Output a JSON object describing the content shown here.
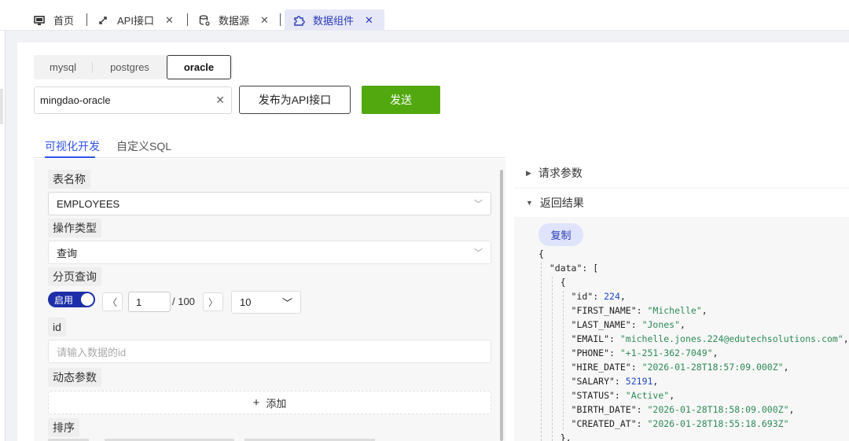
{
  "tabs": [
    {
      "label": "首页",
      "icon": "monitor-icon",
      "closable": false
    },
    {
      "label": "API接口",
      "icon": "link-icon",
      "closable": true
    },
    {
      "label": "数据源",
      "icon": "database-icon",
      "closable": true
    },
    {
      "label": "数据组件",
      "icon": "puzzle-icon",
      "closable": true,
      "active": true
    }
  ],
  "db_types": [
    "mysql",
    "postgres",
    "oracle"
  ],
  "db_selected": "oracle",
  "connection": {
    "value": "mingdao-oracle"
  },
  "actions": {
    "publish": "发布为API接口",
    "send": "发送"
  },
  "subtabs": [
    "可视化开发",
    "自定义SQL"
  ],
  "form": {
    "table_label": "表名称",
    "table_value": "EMPLOYEES",
    "op_label": "操作类型",
    "op_value": "查询",
    "paging_label": "分页查询",
    "paging_toggle": "启用",
    "page_current": "1",
    "page_total": "/ 100",
    "page_size": "10",
    "id_label": "id",
    "id_placeholder": "请输入数据的id",
    "dyn_label": "动态参数",
    "add_label": "添加",
    "sort_label": "排序"
  },
  "result": {
    "params_label": "请求参数",
    "result_label": "返回结果",
    "copy_label": "复制",
    "lines": [
      {
        "indent": 0,
        "k": "",
        "v": "{",
        "t": "p"
      },
      {
        "indent": 1,
        "k": "\"data\": ",
        "v": "[",
        "t": "p"
      },
      {
        "indent": 2,
        "k": "",
        "v": "{",
        "t": "p"
      },
      {
        "indent": 3,
        "k": "\"id\": ",
        "v": "224",
        "t": "n",
        "c": ","
      },
      {
        "indent": 3,
        "k": "\"FIRST_NAME\": ",
        "v": "\"Michelle\"",
        "t": "s",
        "c": ","
      },
      {
        "indent": 3,
        "k": "\"LAST_NAME\": ",
        "v": "\"Jones\"",
        "t": "s",
        "c": ","
      },
      {
        "indent": 3,
        "k": "\"EMAIL\": ",
        "v": "\"michelle.jones.224@edutechsolutions.com\"",
        "t": "s",
        "c": ","
      },
      {
        "indent": 3,
        "k": "\"PHONE\": ",
        "v": "\"+1-251-362-7049\"",
        "t": "s",
        "c": ","
      },
      {
        "indent": 3,
        "k": "\"HIRE_DATE\": ",
        "v": "\"2026-01-28T18:57:09.000Z\"",
        "t": "s",
        "c": ","
      },
      {
        "indent": 3,
        "k": "\"SALARY\": ",
        "v": "52191",
        "t": "n",
        "c": ","
      },
      {
        "indent": 3,
        "k": "\"STATUS\": ",
        "v": "\"Active\"",
        "t": "s",
        "c": ","
      },
      {
        "indent": 3,
        "k": "\"BIRTH_DATE\": ",
        "v": "\"2026-01-28T18:58:09.000Z\"",
        "t": "s",
        "c": ","
      },
      {
        "indent": 3,
        "k": "\"CREATED_AT\": ",
        "v": "\"2026-01-28T18:55:18.693Z\"",
        "t": "s",
        "c": ""
      },
      {
        "indent": 2,
        "k": "",
        "v": "},",
        "t": "p"
      }
    ]
  }
}
